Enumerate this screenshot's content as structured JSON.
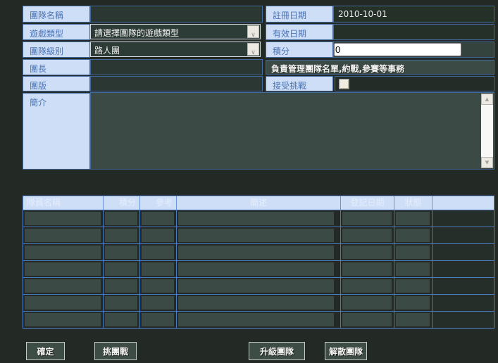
{
  "form": {
    "team_name_label": "團隊名稱",
    "team_name_value": "",
    "game_type_label": "遊戲類型",
    "game_type_selected": "請選擇團隊的遊戲類型",
    "team_level_label": "團隊級別",
    "team_level_selected": "路人團",
    "leader_label": "團長",
    "leader_value": "",
    "board_label": "團版",
    "board_value": "",
    "intro_label": "簡介",
    "intro_value": "",
    "register_date_label": "註冊日期",
    "register_date_value": "2010-10-01",
    "valid_date_label": "有效日期",
    "valid_date_value": "",
    "score_label": "積分",
    "score_value": "0",
    "leader_note": "負責管理團隊名單,約戰,參賽等事務",
    "accept_challenge_label": "接受挑戰",
    "accept_challenge_checked": false
  },
  "icons": {
    "dropdown_arrow": "∨",
    "scroll_up": "▲",
    "scroll_down": "▼"
  },
  "table": {
    "headers": [
      "隊員名稱",
      "積分",
      "參考",
      "簡述",
      "登記日期",
      "狀態",
      ""
    ],
    "empty_rows": 7
  },
  "buttons": {
    "confirm": "確定",
    "challenge": "挑團戰",
    "upgrade": "升級團隊",
    "disband": "解散團隊"
  },
  "colors": {
    "page_bg": "#232a26",
    "label_bg": "#cfdef7",
    "label_text": "#4a74b4",
    "grid_blue": "#4a7ac0",
    "field_dark": "#2a3733",
    "field_inset": "#3c4a45",
    "header_text": "#e4edfc"
  }
}
